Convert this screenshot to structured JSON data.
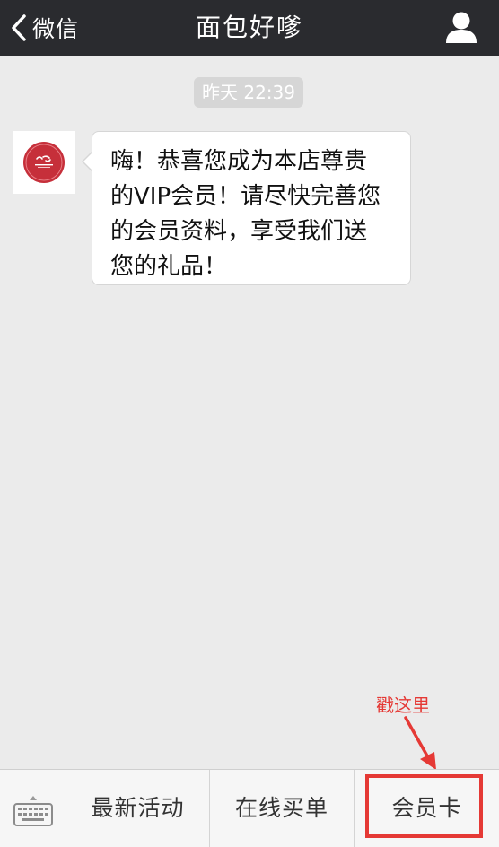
{
  "navbar": {
    "back_label": "微信",
    "title": "面包好嗲",
    "back_icon": "chevron-left-icon",
    "profile_icon": "person-icon"
  },
  "chat": {
    "timestamp": "昨天 22:39",
    "message_lines": [
      "嗨！恭喜您成为本店尊贵",
      "的VIP会员！请尽快完善您",
      "的会员资料，享受我们送",
      "您的礼品！"
    ]
  },
  "annotation": {
    "text": "戳这里",
    "color": "#e53935"
  },
  "toolbar": {
    "keyboard_icon": "keyboard-icon",
    "items": [
      {
        "label": "最新活动"
      },
      {
        "label": "在线买单"
      },
      {
        "label": "会员卡"
      }
    ]
  },
  "colors": {
    "navbar_bg": "#2a2b2f",
    "chat_bg": "#ebebeb",
    "accent_red": "#e53935"
  }
}
